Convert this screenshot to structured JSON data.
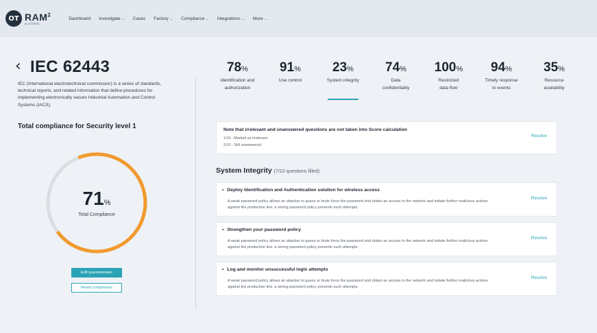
{
  "app": {
    "logo_mark": "OT",
    "name": "RAM",
    "name_sup": "2",
    "by": "by OTORIO"
  },
  "nav": [
    {
      "label": "Dashboard",
      "has_caret": false
    },
    {
      "label": "Investigate",
      "has_caret": true
    },
    {
      "label": "Cases",
      "has_caret": false
    },
    {
      "label": "Factory",
      "has_caret": true
    },
    {
      "label": "Compliance",
      "has_caret": true
    },
    {
      "label": "Integrations",
      "has_caret": true
    },
    {
      "label": "More",
      "has_caret": true
    }
  ],
  "page": {
    "title": "IEC 62443",
    "description": "IEC (International electrotechnical commission) is a series of standards, technical reports, and related information that define procedures for implementing electronically secure Industrial Automation and Control Systems (IACS).",
    "total_title": "Total compliance for Security level 1",
    "gauge": {
      "value": "71",
      "unit": "%",
      "fraction": 0.71,
      "label": "Total Compliance",
      "fill_color": "#f29a2e",
      "track_color": "#d9dee3"
    },
    "edit_button": "Edit questionnaire",
    "reset_button": "Reset compliance"
  },
  "metrics": [
    {
      "value": "78",
      "unit": "%",
      "label1": "Identification and",
      "label2": "authorization",
      "active": false
    },
    {
      "value": "91",
      "unit": "%",
      "label1": "Use control",
      "label2": "",
      "active": false
    },
    {
      "value": "23",
      "unit": "%",
      "label1": "System integrity",
      "label2": "",
      "active": true
    },
    {
      "value": "74",
      "unit": "%",
      "label1": "Data",
      "label2": "confidentiality",
      "active": false
    },
    {
      "value": "100",
      "unit": "%",
      "label1": "Restricted",
      "label2": "data flow",
      "active": false
    },
    {
      "value": "94",
      "unit": "%",
      "label1": "Timely response",
      "label2": "to events",
      "active": false
    },
    {
      "value": "35",
      "unit": "%",
      "label1": "Resource",
      "label2": "availability",
      "active": false
    }
  ],
  "note": {
    "title": "Note that irrelevant and unanswered questions are not taken into Score calculation",
    "line1": "1/10 - Marked as irrelevant",
    "line2": "2/10 - Still unanswered",
    "resolve": "Resolve"
  },
  "section": {
    "title": "System Integrity",
    "subtitle": "(7/10 questions filled)"
  },
  "items": [
    {
      "title": "Deploy Identification and Authentication solution for wireless access",
      "desc": "A weak password policy allows an attacker to guess or brute force the password and obtain an access to the network and initiate further malicious actions against the production line. a strong password policy prevents such attempts.",
      "resolve": "Resolve"
    },
    {
      "title": "Strengthen your password policy",
      "desc": "A weak password policy allows an attacker to guess or brute force the password and obtain an access to the network and initiate further malicious actions against the production line. a strong password policy prevents such attempts.",
      "resolve": "Resolve"
    },
    {
      "title": "Log and monitor unsuccessful login attempts",
      "desc": "A weak password policy allows an attacker to guess or brute force the password and obtain an access to the network and initiate further malicious actions against the production line. a strong password policy prevents such attempts.",
      "resolve": "Resolve"
    }
  ]
}
